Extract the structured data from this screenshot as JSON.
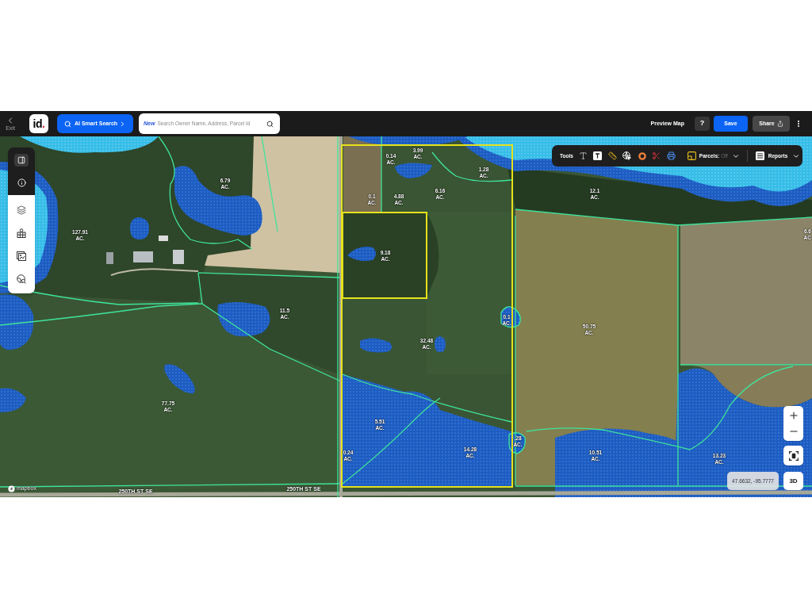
{
  "header": {
    "exit": {
      "label": "Exit"
    },
    "logo": {
      "letters": "id",
      "dot": "."
    },
    "ai_search": {
      "label": "AI Smart Search"
    },
    "search": {
      "badge": "New",
      "placeholder": "Search Owner Name, Address, Parcel Id"
    },
    "actions": {
      "preview": "Preview Map",
      "help": "?",
      "save": "Save",
      "share": "Share"
    }
  },
  "toolbar": {
    "label": "Tools",
    "parcels": {
      "label": "Parcels:",
      "value": "Off"
    },
    "reports": {
      "label": "Reports"
    }
  },
  "map": {
    "parcels": [
      {
        "acres": "3.99",
        "unit": "AC."
      },
      {
        "acres": "0.14",
        "unit": "AC."
      },
      {
        "acres": "1.28",
        "unit": "AC."
      },
      {
        "acres": "6.79",
        "unit": "AC."
      },
      {
        "acres": "6.16",
        "unit": "AC."
      },
      {
        "acres": "12.1",
        "unit": "AC."
      },
      {
        "acres": "0.1",
        "unit": "AC."
      },
      {
        "acres": "4.88",
        "unit": "AC."
      },
      {
        "acres": "127.91",
        "unit": "AC."
      },
      {
        "acres": "6.6",
        "unit": "AC"
      },
      {
        "acres": "9.18",
        "unit": "AC."
      },
      {
        "acres": "11.5",
        "unit": "AC."
      },
      {
        "acres": "0.1",
        "unit": "AC."
      },
      {
        "acres": "50.75",
        "unit": "AC."
      },
      {
        "acres": "32.48",
        "unit": "AC."
      },
      {
        "acres": "77.75",
        "unit": "AC."
      },
      {
        "acres": "5.51",
        "unit": "AC."
      },
      {
        "acres": ".28",
        "unit": "AC."
      },
      {
        "acres": "14.28",
        "unit": "AC."
      },
      {
        "acres": "0.24",
        "unit": "AC."
      },
      {
        "acres": "10.51",
        "unit": "AC."
      },
      {
        "acres": "13.23",
        "unit": "AC."
      }
    ],
    "roads": [
      "250TH ST SE",
      "250TH ST SE"
    ],
    "attribution": "mapbox",
    "coordinates": "47.6632, -95.7777",
    "view_toggle": "3D"
  }
}
